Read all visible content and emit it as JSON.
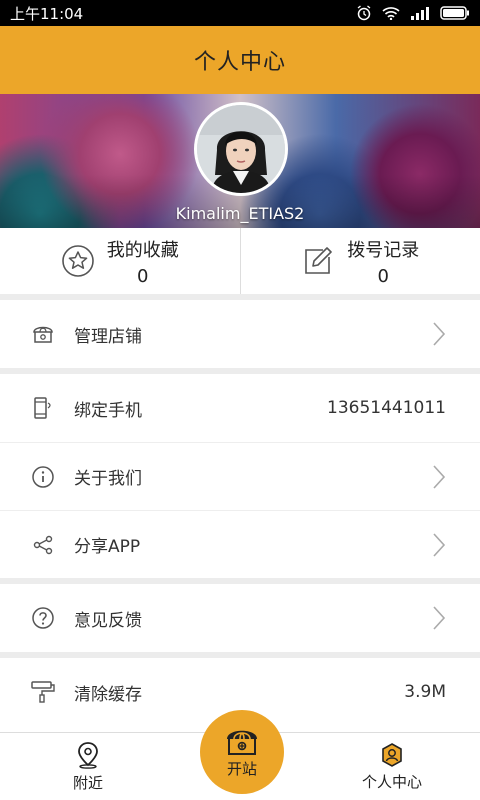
{
  "status_bar": {
    "time": "上午11:04"
  },
  "header": {
    "title": "个人中心"
  },
  "profile": {
    "username": "Kimalim_ETIAS2"
  },
  "stats": [
    {
      "label": "我的收藏",
      "value": "0",
      "icon": "star-icon"
    },
    {
      "label": "拨号记录",
      "value": "0",
      "icon": "edit-icon"
    }
  ],
  "menu": {
    "manage_store": {
      "label": "管理店铺",
      "icon": "store-icon"
    },
    "bind_phone": {
      "label": "绑定手机",
      "value": "13651441011",
      "icon": "phone-icon"
    },
    "about_us": {
      "label": "关于我们",
      "icon": "info-icon"
    },
    "share_app": {
      "label": "分享APP",
      "icon": "share-icon"
    },
    "feedback": {
      "label": "意见反馈",
      "icon": "help-icon"
    },
    "clear_cache": {
      "label": "清除缓存",
      "value": "3.9M",
      "icon": "paint-roller-icon"
    }
  },
  "bottom_nav": {
    "nearby": {
      "label": "附近",
      "icon": "location-pin-icon"
    },
    "open_shop": {
      "label": "开站",
      "icon": "store-icon"
    },
    "profile": {
      "label": "个人中心",
      "icon": "user-icon"
    }
  },
  "colors": {
    "accent": "#eca629",
    "background": "#ececec"
  }
}
